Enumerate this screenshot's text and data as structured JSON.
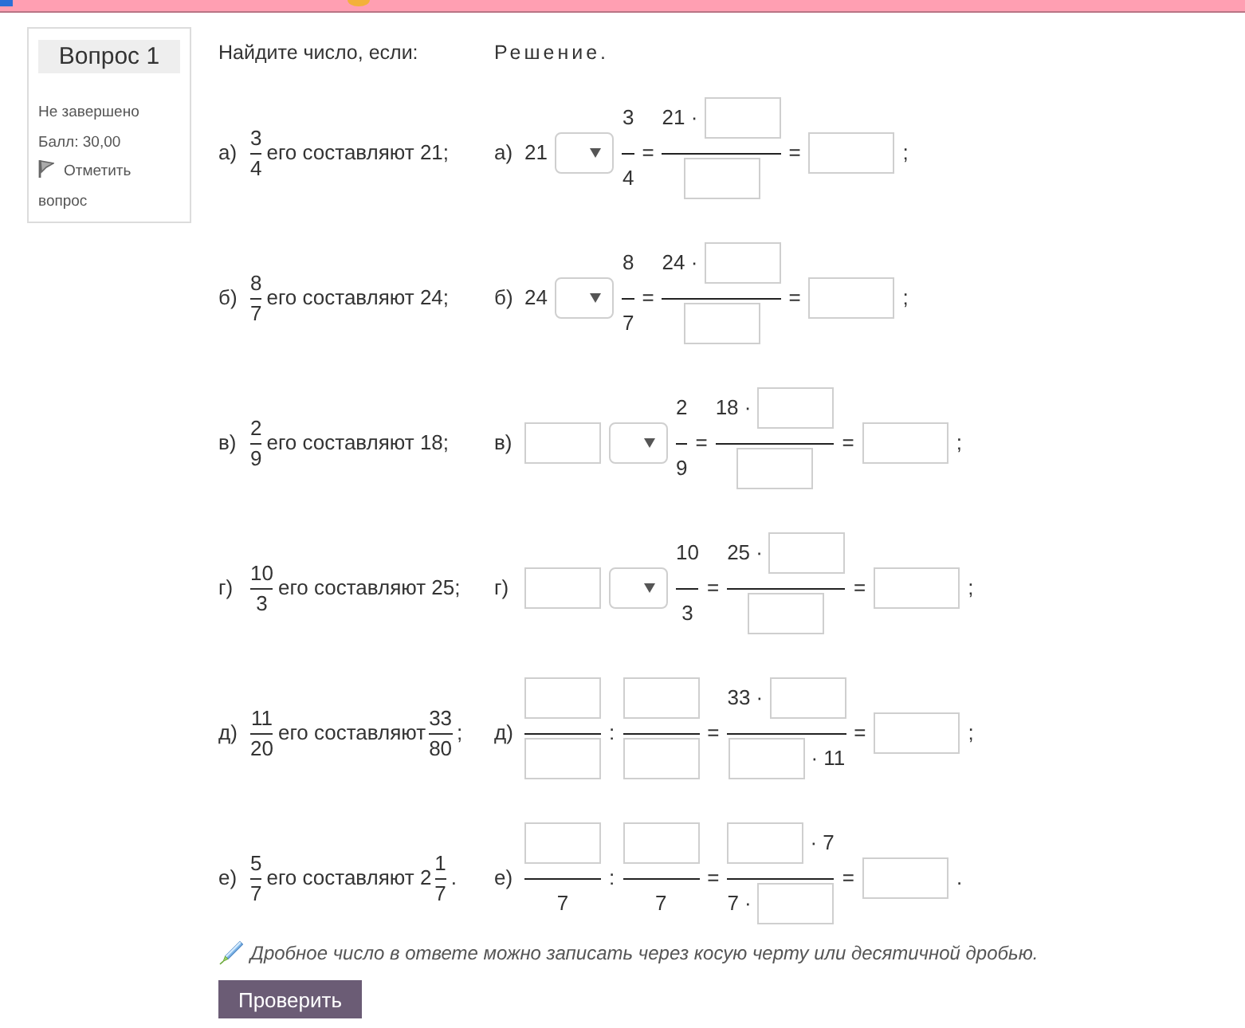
{
  "question_info": {
    "title": "Вопрос 1",
    "status": "Не завершено",
    "grade": "Балл: 30,00",
    "flag_label": "Отметить вопрос"
  },
  "task": {
    "prompt": "Найдите число, если:",
    "solution_heading": "Решение."
  },
  "problems": [
    {
      "label": "а)",
      "parts": [
        {
          "kind": "fraction",
          "num": "3",
          "den": "4"
        },
        {
          "kind": "text",
          "text": "его составляют 21;"
        }
      ],
      "solution": {
        "label": "а)",
        "parts": [
          {
            "kind": "text",
            "text": "21"
          },
          {
            "kind": "select"
          },
          {
            "kind": "fraction",
            "num": [
              {
                "kind": "text",
                "text": "3"
              }
            ],
            "den": [
              {
                "kind": "text",
                "text": "4"
              }
            ]
          },
          {
            "kind": "text",
            "text": "="
          },
          {
            "kind": "fraction",
            "num": [
              {
                "kind": "text",
                "text": "21 ·"
              },
              {
                "kind": "input"
              }
            ],
            "den": [
              {
                "kind": "input"
              }
            ]
          },
          {
            "kind": "text",
            "text": "="
          },
          {
            "kind": "result"
          },
          {
            "kind": "text",
            "text": ";"
          }
        ]
      }
    },
    {
      "label": "б)",
      "parts": [
        {
          "kind": "fraction",
          "num": "8",
          "den": "7"
        },
        {
          "kind": "text",
          "text": "его составляют 24;"
        }
      ],
      "solution": {
        "label": "б)",
        "parts": [
          {
            "kind": "text",
            "text": "24"
          },
          {
            "kind": "select"
          },
          {
            "kind": "fraction",
            "num": [
              {
                "kind": "text",
                "text": "8"
              }
            ],
            "den": [
              {
                "kind": "text",
                "text": "7"
              }
            ]
          },
          {
            "kind": "text",
            "text": "="
          },
          {
            "kind": "fraction",
            "num": [
              {
                "kind": "text",
                "text": "24 ·"
              },
              {
                "kind": "input"
              }
            ],
            "den": [
              {
                "kind": "input"
              }
            ]
          },
          {
            "kind": "text",
            "text": "="
          },
          {
            "kind": "result"
          },
          {
            "kind": "text",
            "text": ";"
          }
        ]
      }
    },
    {
      "label": "в)",
      "parts": [
        {
          "kind": "fraction",
          "num": "2",
          "den": "9"
        },
        {
          "kind": "text",
          "text": "его составляют 18;"
        }
      ],
      "solution": {
        "label": "в)",
        "parts": [
          {
            "kind": "input"
          },
          {
            "kind": "select"
          },
          {
            "kind": "fraction",
            "num": [
              {
                "kind": "text",
                "text": "2"
              }
            ],
            "den": [
              {
                "kind": "text",
                "text": "9"
              }
            ]
          },
          {
            "kind": "text",
            "text": "="
          },
          {
            "kind": "fraction",
            "num": [
              {
                "kind": "text",
                "text": "18 ·"
              },
              {
                "kind": "input"
              }
            ],
            "den": [
              {
                "kind": "input"
              }
            ]
          },
          {
            "kind": "text",
            "text": "="
          },
          {
            "kind": "result"
          },
          {
            "kind": "text",
            "text": ";"
          }
        ]
      }
    },
    {
      "label": "г)",
      "parts": [
        {
          "kind": "fraction",
          "num": "10",
          "den": "3"
        },
        {
          "kind": "text",
          "text": "его составляют 25;"
        }
      ],
      "solution": {
        "label": "г)",
        "parts": [
          {
            "kind": "input"
          },
          {
            "kind": "select"
          },
          {
            "kind": "fraction",
            "num": [
              {
                "kind": "text",
                "text": "10"
              }
            ],
            "den": [
              {
                "kind": "text",
                "text": "3"
              }
            ]
          },
          {
            "kind": "text",
            "text": "="
          },
          {
            "kind": "fraction",
            "num": [
              {
                "kind": "text",
                "text": "25 ·"
              },
              {
                "kind": "input"
              }
            ],
            "den": [
              {
                "kind": "input"
              }
            ]
          },
          {
            "kind": "text",
            "text": "="
          },
          {
            "kind": "result"
          },
          {
            "kind": "text",
            "text": ";"
          }
        ]
      }
    },
    {
      "label": "д)",
      "parts": [
        {
          "kind": "fraction",
          "num": "11",
          "den": "20"
        },
        {
          "kind": "text",
          "text": "его составляют"
        },
        {
          "kind": "fraction",
          "num": "33",
          "den": "80"
        },
        {
          "kind": "text",
          "text": ";"
        }
      ],
      "solution": {
        "label": "д)",
        "parts": [
          {
            "kind": "fraction",
            "num": [
              {
                "kind": "input"
              }
            ],
            "den": [
              {
                "kind": "input"
              }
            ]
          },
          {
            "kind": "text",
            "text": ":"
          },
          {
            "kind": "fraction",
            "num": [
              {
                "kind": "input"
              }
            ],
            "den": [
              {
                "kind": "input"
              }
            ]
          },
          {
            "kind": "text",
            "text": "="
          },
          {
            "kind": "fraction",
            "num": [
              {
                "kind": "text",
                "text": "33 ·"
              },
              {
                "kind": "input"
              }
            ],
            "den": [
              {
                "kind": "input"
              },
              {
                "kind": "text",
                "text": "· 11"
              }
            ]
          },
          {
            "kind": "text",
            "text": "="
          },
          {
            "kind": "result"
          },
          {
            "kind": "text",
            "text": ";"
          }
        ]
      }
    },
    {
      "label": "е)",
      "parts": [
        {
          "kind": "fraction",
          "num": "5",
          "den": "7"
        },
        {
          "kind": "text",
          "text": "его составляют 2"
        },
        {
          "kind": "fraction",
          "num": "1",
          "den": "7"
        },
        {
          "kind": "text",
          "text": "."
        }
      ],
      "solution": {
        "label": "е)",
        "parts": [
          {
            "kind": "fraction",
            "num": [
              {
                "kind": "input"
              }
            ],
            "den": [
              {
                "kind": "text",
                "text": "7"
              }
            ]
          },
          {
            "kind": "text",
            "text": ":"
          },
          {
            "kind": "fraction",
            "num": [
              {
                "kind": "input"
              }
            ],
            "den": [
              {
                "kind": "text",
                "text": "7"
              }
            ]
          },
          {
            "kind": "text",
            "text": "="
          },
          {
            "kind": "fraction",
            "num": [
              {
                "kind": "input"
              },
              {
                "kind": "text",
                "text": "· 7"
              }
            ],
            "den": [
              {
                "kind": "text",
                "text": "7 ·"
              },
              {
                "kind": "input"
              }
            ]
          },
          {
            "kind": "text",
            "text": "="
          },
          {
            "kind": "result"
          },
          {
            "kind": "text",
            "text": "."
          }
        ]
      }
    }
  ],
  "hint": "Дробное число в ответе можно записать через косую черту или десятичной дробью.",
  "check_button": "Проверить"
}
